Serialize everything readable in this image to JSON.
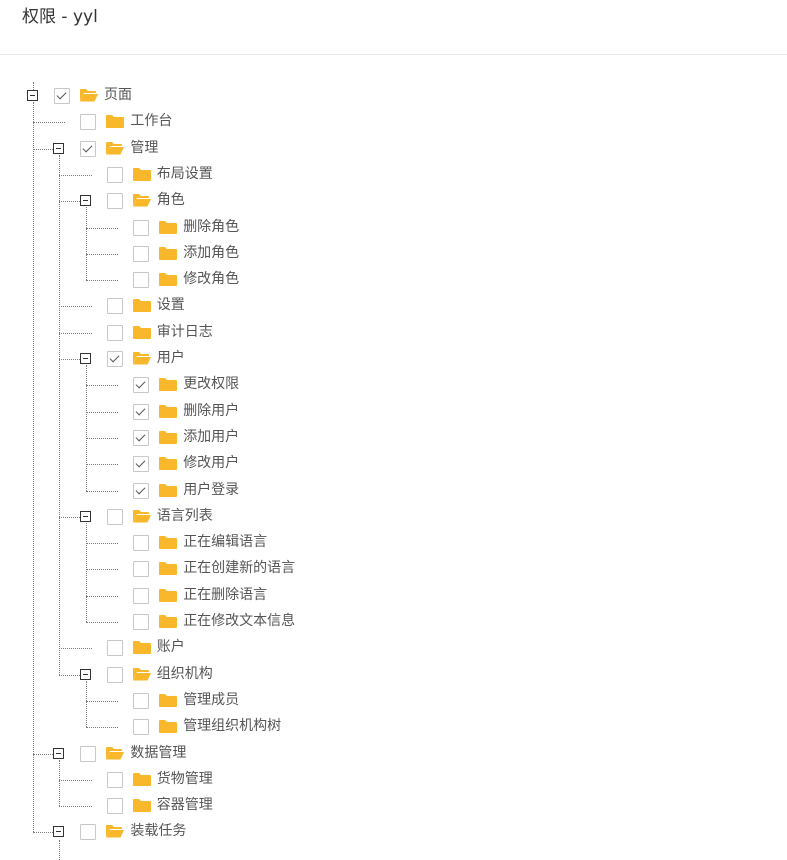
{
  "title": "权限 - yyl",
  "colors": {
    "folder": "#f9b82b",
    "text": "#555555",
    "line": "#7a7a7a"
  },
  "tree": [
    {
      "label": "页面",
      "checked": true,
      "open": true,
      "children": [
        {
          "label": "工作台",
          "checked": false
        },
        {
          "label": "管理",
          "checked": true,
          "open": true,
          "children": [
            {
              "label": "布局设置",
              "checked": false
            },
            {
              "label": "角色",
              "checked": false,
              "open": true,
              "children": [
                {
                  "label": "删除角色",
                  "checked": false
                },
                {
                  "label": "添加角色",
                  "checked": false
                },
                {
                  "label": "修改角色",
                  "checked": false
                }
              ]
            },
            {
              "label": "设置",
              "checked": false
            },
            {
              "label": "审计日志",
              "checked": false
            },
            {
              "label": "用户",
              "checked": true,
              "open": true,
              "children": [
                {
                  "label": "更改权限",
                  "checked": true
                },
                {
                  "label": "删除用户",
                  "checked": true
                },
                {
                  "label": "添加用户",
                  "checked": true
                },
                {
                  "label": "修改用户",
                  "checked": true
                },
                {
                  "label": "用户登录",
                  "checked": true
                }
              ]
            },
            {
              "label": "语言列表",
              "checked": false,
              "open": true,
              "children": [
                {
                  "label": "正在编辑语言",
                  "checked": false
                },
                {
                  "label": "正在创建新的语言",
                  "checked": false
                },
                {
                  "label": "正在删除语言",
                  "checked": false
                },
                {
                  "label": "正在修改文本信息",
                  "checked": false
                }
              ]
            },
            {
              "label": "账户",
              "checked": false
            },
            {
              "label": "组织机构",
              "checked": false,
              "open": true,
              "children": [
                {
                  "label": "管理成员",
                  "checked": false
                },
                {
                  "label": "管理组织机构树",
                  "checked": false
                }
              ]
            }
          ]
        },
        {
          "label": "数据管理",
          "checked": false,
          "open": true,
          "children": [
            {
              "label": "货物管理",
              "checked": false
            },
            {
              "label": "容器管理",
              "checked": false
            }
          ]
        },
        {
          "label": "装载任务",
          "checked": false,
          "open": true,
          "children": []
        }
      ]
    }
  ]
}
